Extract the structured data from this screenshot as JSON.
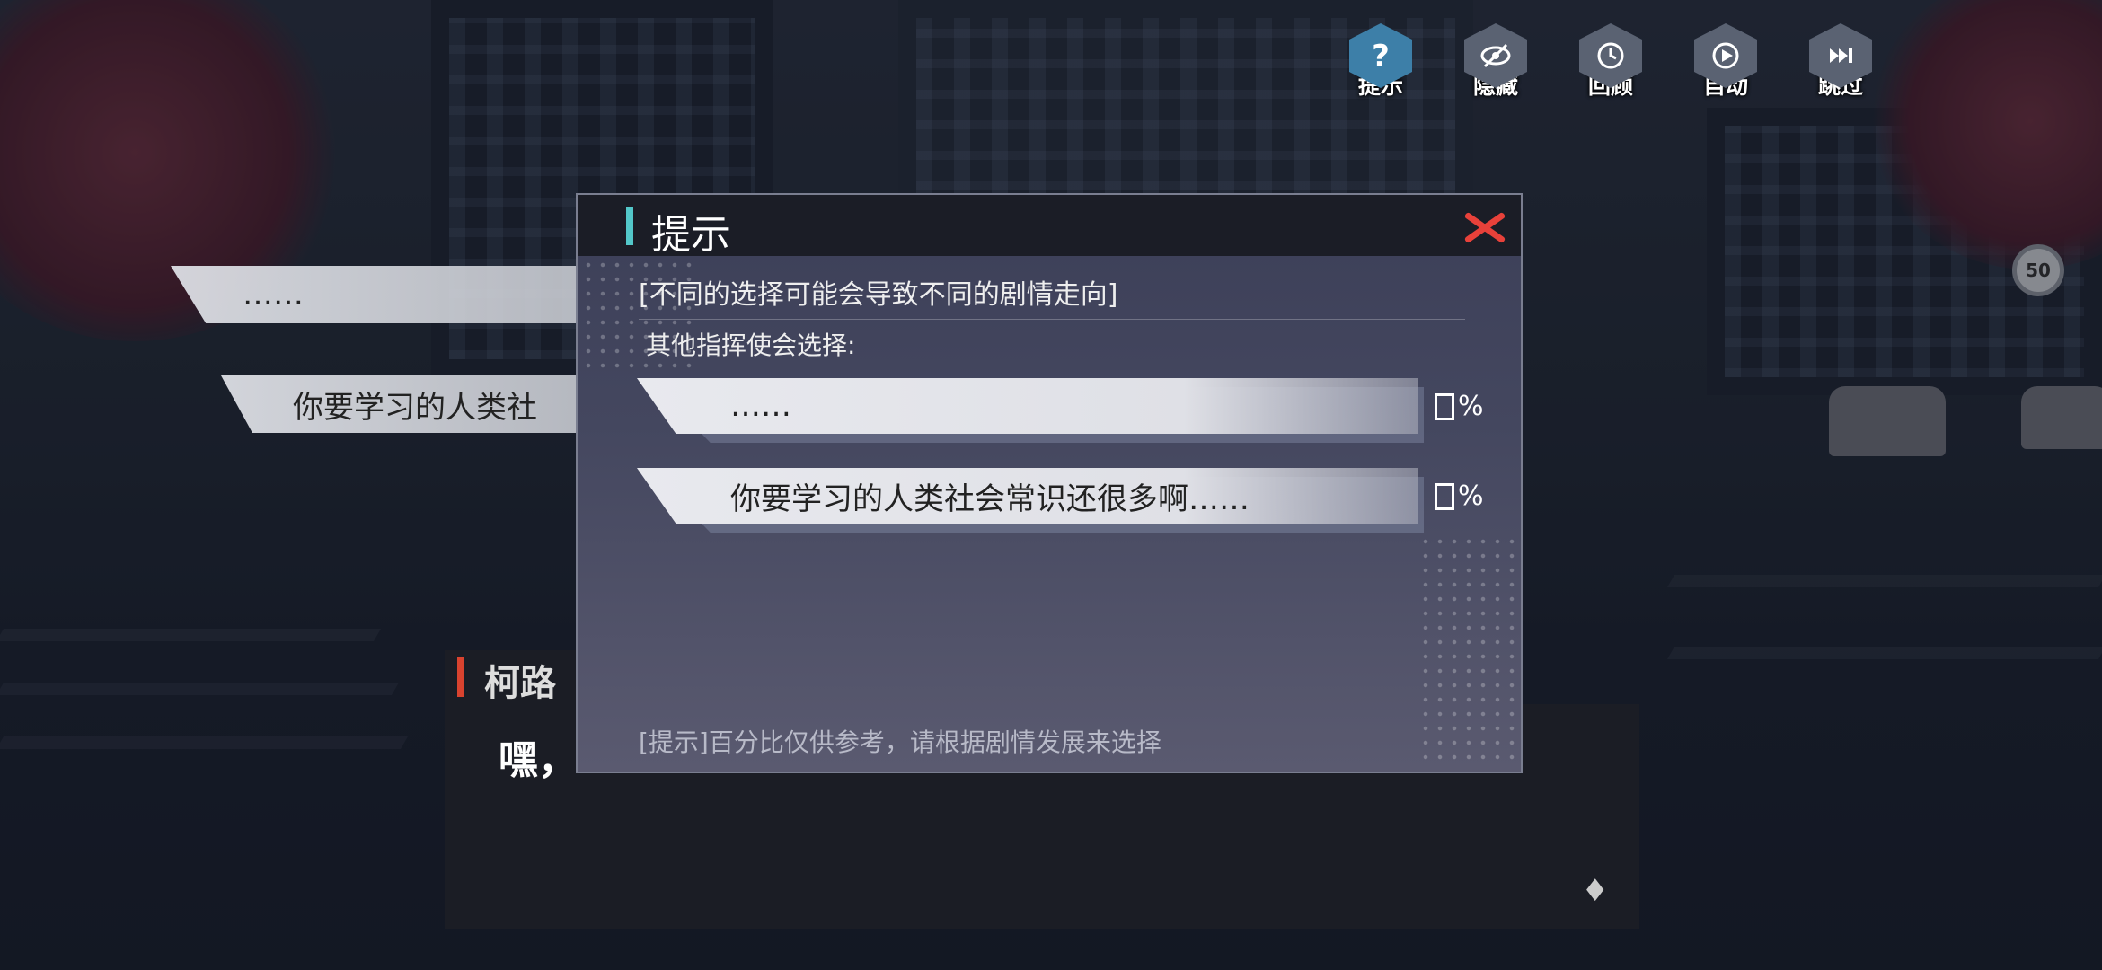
{
  "toolbar": [
    {
      "icon": "question-icon",
      "label": "提示"
    },
    {
      "icon": "eye-slash-icon",
      "label": "隐藏"
    },
    {
      "icon": "history-icon",
      "label": "回顾"
    },
    {
      "icon": "play-icon",
      "label": "自动"
    },
    {
      "icon": "fast-forward-icon",
      "label": "跳过"
    }
  ],
  "background_choices": [
    "……",
    "你要学习的人类社"
  ],
  "dialogue": {
    "speaker": "柯路",
    "line": "嘿，",
    "next_icon": "♦"
  },
  "street_sign": "50",
  "hint_modal": {
    "title": "提示",
    "notice": "[不同的选择可能会导致不同的剧情走向]",
    "subtitle": "其他指挥使会选择:",
    "options": [
      {
        "text": "……",
        "percent_suffix": "%"
      },
      {
        "text": "你要学习的人类社会常识还很多啊……",
        "percent_suffix": "%"
      }
    ],
    "footer": "[提示]百分比仅供参考，请根据剧情发展来选择"
  },
  "colors": {
    "accent": "#53c7c9",
    "close": "#e8413a",
    "speaker_bar": "#d9432f",
    "active_tool": "#3d7fa8"
  }
}
